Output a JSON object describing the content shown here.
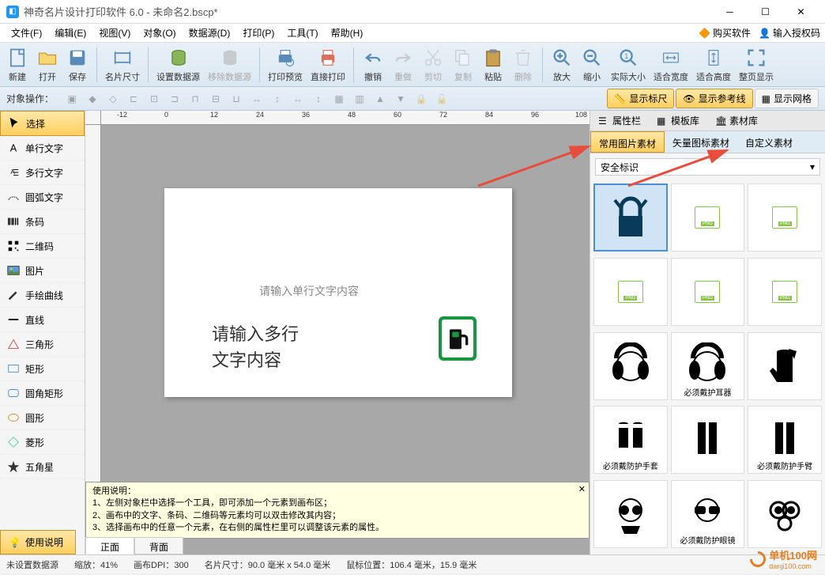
{
  "titlebar": {
    "app_name": "神奇名片设计打印软件 6.0",
    "document": "未命名2.bscp*"
  },
  "menubar": {
    "items": [
      "文件(F)",
      "编辑(E)",
      "视图(V)",
      "对象(O)",
      "数据源(D)",
      "打印(P)",
      "工具(T)",
      "帮助(H)"
    ],
    "right_links": [
      "购买软件",
      "输入授权码"
    ]
  },
  "toolbar": {
    "items": [
      "新建",
      "打开",
      "保存",
      "名片尺寸",
      "设置数据源",
      "移除数据源",
      "打印预览",
      "直接打印",
      "撤销",
      "重做",
      "剪切",
      "复制",
      "粘贴",
      "删除",
      "放大",
      "缩小",
      "实际大小",
      "适合宽度",
      "适合高度",
      "整页显示"
    ]
  },
  "opsbar": {
    "label": "对象操作：",
    "toggles": [
      "显示标尺",
      "显示参考线",
      "显示网格"
    ]
  },
  "left_tools": {
    "items": [
      {
        "label": "选择",
        "icon": "cursor"
      },
      {
        "label": "单行文字",
        "icon": "text-single"
      },
      {
        "label": "多行文字",
        "icon": "text-multi"
      },
      {
        "label": "圆弧文字",
        "icon": "text-arc"
      },
      {
        "label": "条码",
        "icon": "barcode"
      },
      {
        "label": "二维码",
        "icon": "qrcode"
      },
      {
        "label": "图片",
        "icon": "image"
      },
      {
        "label": "手绘曲线",
        "icon": "pencil"
      },
      {
        "label": "直线",
        "icon": "line"
      },
      {
        "label": "三角形",
        "icon": "triangle"
      },
      {
        "label": "矩形",
        "icon": "rect"
      },
      {
        "label": "圆角矩形",
        "icon": "round-rect"
      },
      {
        "label": "圆形",
        "icon": "circle"
      },
      {
        "label": "菱形",
        "icon": "diamond"
      },
      {
        "label": "五角星",
        "icon": "star"
      }
    ],
    "help_btn": "使用说明"
  },
  "ruler": {
    "ticks": [
      "-12",
      "0",
      "12",
      "24",
      "36",
      "48",
      "60",
      "72",
      "84",
      "96",
      "108"
    ]
  },
  "canvas": {
    "single_text": "请输入单行文字内容",
    "multi_text_l1": "请输入多行",
    "multi_text_l2": "文字内容",
    "tabs": [
      "正面",
      "背面"
    ]
  },
  "help_panel": {
    "title": "使用说明：",
    "lines": [
      "1、左侧对象栏中选择一个工具，即可添加一个元素到画布区；",
      "2、画布中的文字、条码、二维码等元素均可以双击修改其内容；",
      "3、选择画布中的任意一个元素，在右侧的属性栏里可以调整该元素的属性。"
    ]
  },
  "right_panel": {
    "tabs": [
      "属性栏",
      "模板库",
      "素材库"
    ],
    "sub_tabs": [
      "常用图片素材",
      "矢量图标素材",
      "自定义素材"
    ],
    "dropdown": "安全标识",
    "materials": [
      {
        "caption": "",
        "type": "lock"
      },
      {
        "caption": "",
        "type": "png"
      },
      {
        "caption": "",
        "type": "png"
      },
      {
        "caption": "",
        "type": "png"
      },
      {
        "caption": "",
        "type": "png"
      },
      {
        "caption": "",
        "type": "png"
      },
      {
        "caption": "",
        "type": "earmuffs"
      },
      {
        "caption": "必须戴护耳器",
        "type": "ear-protect"
      },
      {
        "caption": "",
        "type": "gloves"
      },
      {
        "caption": "必须戴防护手套",
        "type": "gloves2"
      },
      {
        "caption": "",
        "type": "gloves-long"
      },
      {
        "caption": "必须戴防护手臂",
        "type": "arm-guard"
      },
      {
        "caption": "",
        "type": "goggles"
      },
      {
        "caption": "必须戴防护眼镜",
        "type": "eye-protect"
      },
      {
        "caption": "",
        "type": "mask"
      }
    ]
  },
  "statusbar": {
    "datasource": "未设置数据源",
    "zoom_label": "缩放：",
    "zoom": "41%",
    "dpi_label": "画布DPI：",
    "dpi": "300",
    "size_label": "名片尺寸：",
    "size": "90.0 毫米 x 54.0 毫米",
    "mouse_label": "鼠标位置：",
    "mouse": "106.4 毫米，15.9 毫米"
  },
  "watermark": "单机100网",
  "watermark_url": "danji100.com"
}
